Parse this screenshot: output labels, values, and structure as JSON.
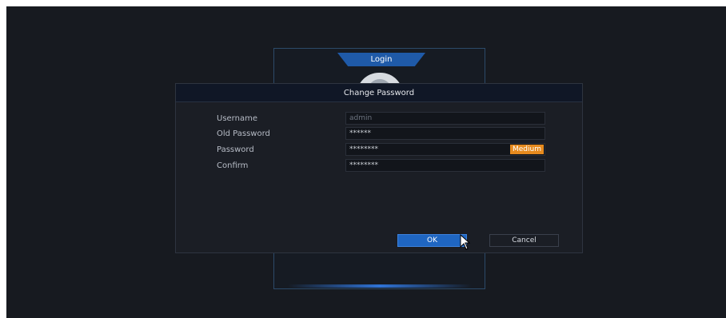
{
  "login": {
    "tab_label": "Login"
  },
  "dialog": {
    "title": "Change Password",
    "fields": [
      {
        "label": "Username",
        "value": "admin"
      },
      {
        "label": "Old Password",
        "value": "******"
      },
      {
        "label": "Password",
        "value": "********",
        "strength": "Medium"
      },
      {
        "label": "Confirm",
        "value": "********"
      }
    ],
    "buttons": {
      "ok": "OK",
      "cancel": "Cancel"
    }
  },
  "colors": {
    "accent": "#1f66c2",
    "strength_medium": "#e68a1e"
  }
}
